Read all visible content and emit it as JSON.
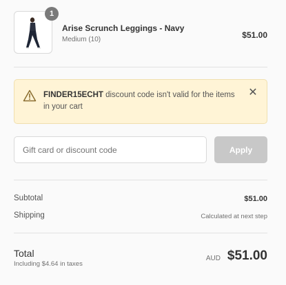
{
  "product": {
    "quantity": "1",
    "name": "Arise Scrunch Leggings - Navy",
    "variant": "Medium (10)",
    "price": "$51.00"
  },
  "alert": {
    "code": "FINDER15ECHT",
    "message": " discount code isn't valid for the items in your cart",
    "icon": "warning-triangle-icon",
    "close_icon": "close-icon"
  },
  "discount": {
    "placeholder": "Gift card or discount code",
    "apply_label": "Apply"
  },
  "summary": {
    "subtotal_label": "Subtotal",
    "subtotal_value": "$51.00",
    "shipping_label": "Shipping",
    "shipping_value": "Calculated at next step"
  },
  "total": {
    "label": "Total",
    "tax_note": "Including $4.64 in taxes",
    "currency": "AUD",
    "amount": "$51.00"
  },
  "colors": {
    "alert_bg": "#fff4d6",
    "apply_disabled": "#c8c8c8",
    "badge": "#7a7a7a"
  }
}
